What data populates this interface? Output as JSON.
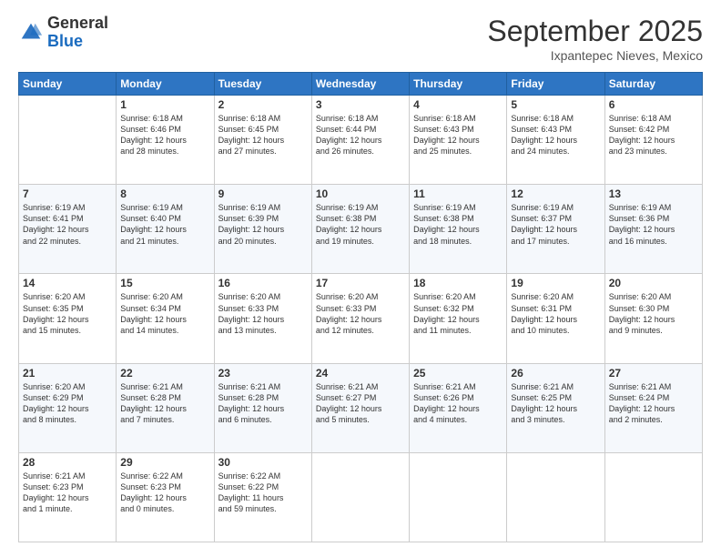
{
  "header": {
    "logo": {
      "line1": "General",
      "line2": "Blue"
    },
    "month": "September 2025",
    "location": "Ixpantepec Nieves, Mexico"
  },
  "weekdays": [
    "Sunday",
    "Monday",
    "Tuesday",
    "Wednesday",
    "Thursday",
    "Friday",
    "Saturday"
  ],
  "weeks": [
    [
      {
        "day": "",
        "info": ""
      },
      {
        "day": "1",
        "info": "Sunrise: 6:18 AM\nSunset: 6:46 PM\nDaylight: 12 hours\nand 28 minutes."
      },
      {
        "day": "2",
        "info": "Sunrise: 6:18 AM\nSunset: 6:45 PM\nDaylight: 12 hours\nand 27 minutes."
      },
      {
        "day": "3",
        "info": "Sunrise: 6:18 AM\nSunset: 6:44 PM\nDaylight: 12 hours\nand 26 minutes."
      },
      {
        "day": "4",
        "info": "Sunrise: 6:18 AM\nSunset: 6:43 PM\nDaylight: 12 hours\nand 25 minutes."
      },
      {
        "day": "5",
        "info": "Sunrise: 6:18 AM\nSunset: 6:43 PM\nDaylight: 12 hours\nand 24 minutes."
      },
      {
        "day": "6",
        "info": "Sunrise: 6:18 AM\nSunset: 6:42 PM\nDaylight: 12 hours\nand 23 minutes."
      }
    ],
    [
      {
        "day": "7",
        "info": "Sunrise: 6:19 AM\nSunset: 6:41 PM\nDaylight: 12 hours\nand 22 minutes."
      },
      {
        "day": "8",
        "info": "Sunrise: 6:19 AM\nSunset: 6:40 PM\nDaylight: 12 hours\nand 21 minutes."
      },
      {
        "day": "9",
        "info": "Sunrise: 6:19 AM\nSunset: 6:39 PM\nDaylight: 12 hours\nand 20 minutes."
      },
      {
        "day": "10",
        "info": "Sunrise: 6:19 AM\nSunset: 6:38 PM\nDaylight: 12 hours\nand 19 minutes."
      },
      {
        "day": "11",
        "info": "Sunrise: 6:19 AM\nSunset: 6:38 PM\nDaylight: 12 hours\nand 18 minutes."
      },
      {
        "day": "12",
        "info": "Sunrise: 6:19 AM\nSunset: 6:37 PM\nDaylight: 12 hours\nand 17 minutes."
      },
      {
        "day": "13",
        "info": "Sunrise: 6:19 AM\nSunset: 6:36 PM\nDaylight: 12 hours\nand 16 minutes."
      }
    ],
    [
      {
        "day": "14",
        "info": "Sunrise: 6:20 AM\nSunset: 6:35 PM\nDaylight: 12 hours\nand 15 minutes."
      },
      {
        "day": "15",
        "info": "Sunrise: 6:20 AM\nSunset: 6:34 PM\nDaylight: 12 hours\nand 14 minutes."
      },
      {
        "day": "16",
        "info": "Sunrise: 6:20 AM\nSunset: 6:33 PM\nDaylight: 12 hours\nand 13 minutes."
      },
      {
        "day": "17",
        "info": "Sunrise: 6:20 AM\nSunset: 6:33 PM\nDaylight: 12 hours\nand 12 minutes."
      },
      {
        "day": "18",
        "info": "Sunrise: 6:20 AM\nSunset: 6:32 PM\nDaylight: 12 hours\nand 11 minutes."
      },
      {
        "day": "19",
        "info": "Sunrise: 6:20 AM\nSunset: 6:31 PM\nDaylight: 12 hours\nand 10 minutes."
      },
      {
        "day": "20",
        "info": "Sunrise: 6:20 AM\nSunset: 6:30 PM\nDaylight: 12 hours\nand 9 minutes."
      }
    ],
    [
      {
        "day": "21",
        "info": "Sunrise: 6:20 AM\nSunset: 6:29 PM\nDaylight: 12 hours\nand 8 minutes."
      },
      {
        "day": "22",
        "info": "Sunrise: 6:21 AM\nSunset: 6:28 PM\nDaylight: 12 hours\nand 7 minutes."
      },
      {
        "day": "23",
        "info": "Sunrise: 6:21 AM\nSunset: 6:28 PM\nDaylight: 12 hours\nand 6 minutes."
      },
      {
        "day": "24",
        "info": "Sunrise: 6:21 AM\nSunset: 6:27 PM\nDaylight: 12 hours\nand 5 minutes."
      },
      {
        "day": "25",
        "info": "Sunrise: 6:21 AM\nSunset: 6:26 PM\nDaylight: 12 hours\nand 4 minutes."
      },
      {
        "day": "26",
        "info": "Sunrise: 6:21 AM\nSunset: 6:25 PM\nDaylight: 12 hours\nand 3 minutes."
      },
      {
        "day": "27",
        "info": "Sunrise: 6:21 AM\nSunset: 6:24 PM\nDaylight: 12 hours\nand 2 minutes."
      }
    ],
    [
      {
        "day": "28",
        "info": "Sunrise: 6:21 AM\nSunset: 6:23 PM\nDaylight: 12 hours\nand 1 minute."
      },
      {
        "day": "29",
        "info": "Sunrise: 6:22 AM\nSunset: 6:23 PM\nDaylight: 12 hours\nand 0 minutes."
      },
      {
        "day": "30",
        "info": "Sunrise: 6:22 AM\nSunset: 6:22 PM\nDaylight: 11 hours\nand 59 minutes."
      },
      {
        "day": "",
        "info": ""
      },
      {
        "day": "",
        "info": ""
      },
      {
        "day": "",
        "info": ""
      },
      {
        "day": "",
        "info": ""
      }
    ]
  ]
}
